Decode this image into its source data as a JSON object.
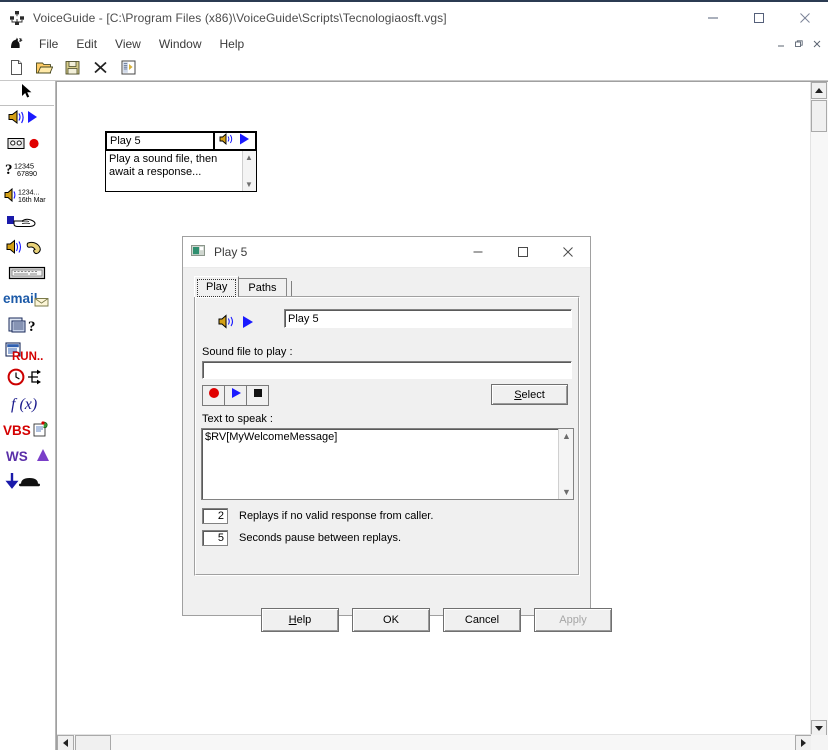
{
  "window": {
    "icon": "voiceguide-app-icon",
    "title": "VoiceGuide - [C:\\Program Files (x86)\\VoiceGuide\\Scripts\\Tecnologiaosft.vgs]",
    "controls": [
      {
        "name": "minimize",
        "glyph": "—"
      },
      {
        "name": "maximize",
        "glyph": "☐"
      },
      {
        "name": "close",
        "glyph": "✕"
      }
    ]
  },
  "menubar": {
    "icon": "voiceguide-document-icon",
    "items": [
      {
        "label": "File"
      },
      {
        "label": "Edit"
      },
      {
        "label": "View"
      },
      {
        "label": "Window"
      },
      {
        "label": "Help"
      }
    ],
    "mdi_controls": [
      {
        "name": "mdi-minimize",
        "glyph": "–"
      },
      {
        "name": "mdi-restore",
        "glyph": "❐"
      },
      {
        "name": "mdi-close",
        "glyph": "✕"
      }
    ]
  },
  "toolbar": {
    "buttons": [
      {
        "name": "new-file-button",
        "icon": "new-document-icon"
      },
      {
        "name": "open-file-button",
        "icon": "open-folder-icon"
      },
      {
        "name": "save-file-button",
        "icon": "floppy-disk-save-icon"
      },
      {
        "name": "delete-button",
        "icon": "black-x-delete-icon"
      },
      {
        "name": "script-properties-button",
        "icon": "script-properties-icon"
      }
    ]
  },
  "palette": {
    "items": [
      {
        "name": "pointer-tool",
        "icon": "arrow-pointer-icon",
        "label": "Pointer"
      },
      {
        "name": "play-module",
        "icon": "speaker-play-icon",
        "label": "Play"
      },
      {
        "name": "record-module",
        "icon": "cassette-record-icon",
        "label": "Record"
      },
      {
        "name": "get-number-module",
        "icon": "question-digits-icon",
        "label": "Get Number"
      },
      {
        "name": "say-datetime-module",
        "icon": "speaker-date-icon",
        "label": "Say Date/Time"
      },
      {
        "name": "goto-module",
        "icon": "hand-pointing-icon",
        "label": "Goto"
      },
      {
        "name": "transfer-module",
        "icon": "speaker-handset-icon",
        "label": "Transfer"
      },
      {
        "name": "keyboard-module",
        "icon": "keyboard-icon",
        "label": "Keyboard"
      },
      {
        "name": "email-module",
        "icon": "email-icon",
        "label": "Email"
      },
      {
        "name": "database-query-module",
        "icon": "database-question-icon",
        "label": "Database Query"
      },
      {
        "name": "run-module",
        "icon": "run-program-icon",
        "label": "Run"
      },
      {
        "name": "schedule-module",
        "icon": "clock-branch-icon",
        "label": "Schedule"
      },
      {
        "name": "function-module",
        "icon": "function-fx-icon",
        "label": "f(x)"
      },
      {
        "name": "vbscript-module",
        "icon": "vbs-script-icon",
        "label": "VBS"
      },
      {
        "name": "webservice-module",
        "icon": "ws-triangle-icon",
        "label": "WS"
      },
      {
        "name": "hangup-module",
        "icon": "down-arrow-telephone-icon",
        "label": "Hangup"
      }
    ]
  },
  "canvas": {
    "node": {
      "title": "Play 5",
      "description": "Play a sound file, then await a response...",
      "icons": [
        "speaker-icon",
        "blue-play-triangle-icon"
      ]
    },
    "vscroll": {
      "up": "▲",
      "down": "▼"
    },
    "hscroll": {
      "left": "◀",
      "right": "▶"
    }
  },
  "dialog": {
    "icon": "module-properties-icon",
    "title": "Play 5",
    "controls": [
      {
        "name": "dialog-minimize",
        "glyph": "—"
      },
      {
        "name": "dialog-maximize",
        "glyph": "☐"
      },
      {
        "name": "dialog-close",
        "glyph": "✕"
      }
    ],
    "tabs": [
      {
        "label": "Play",
        "active": true
      },
      {
        "label": "Paths",
        "active": false
      }
    ],
    "module_icons": [
      "speaker-icon",
      "blue-play-triangle-icon"
    ],
    "module_name_value": "Play 5",
    "sound_file_label": "Sound file to play :",
    "sound_file_value": "",
    "transport": [
      {
        "name": "record-button",
        "icon": "red-record-circle-icon"
      },
      {
        "name": "play-button",
        "icon": "blue-play-triangle-icon"
      },
      {
        "name": "stop-button",
        "icon": "black-stop-square-icon"
      }
    ],
    "select_button": {
      "label": "Select",
      "accel": "S"
    },
    "text_to_speak_label": "Text to speak :",
    "text_to_speak_value": "$RV[MyWelcomeMessage]",
    "replays": {
      "count_value": "2",
      "count_label": "Replays if no valid response from caller.",
      "pause_value": "5",
      "pause_label": "Seconds pause between replays."
    },
    "buttons": [
      {
        "name": "help-button",
        "label": "Help",
        "accel": "H",
        "disabled": false
      },
      {
        "name": "ok-button",
        "label": "OK",
        "accel": "",
        "disabled": false
      },
      {
        "name": "cancel-button",
        "label": "Cancel",
        "accel": "",
        "disabled": false
      },
      {
        "name": "apply-button",
        "label": "Apply",
        "accel": "",
        "disabled": true
      }
    ]
  },
  "colors": {
    "accent_blue": "#0000cc",
    "record_red": "#e00000",
    "speaker_gold": "#d4a017",
    "dialog_face": "#f0f0f0",
    "title_text": "#4c4c4c"
  }
}
